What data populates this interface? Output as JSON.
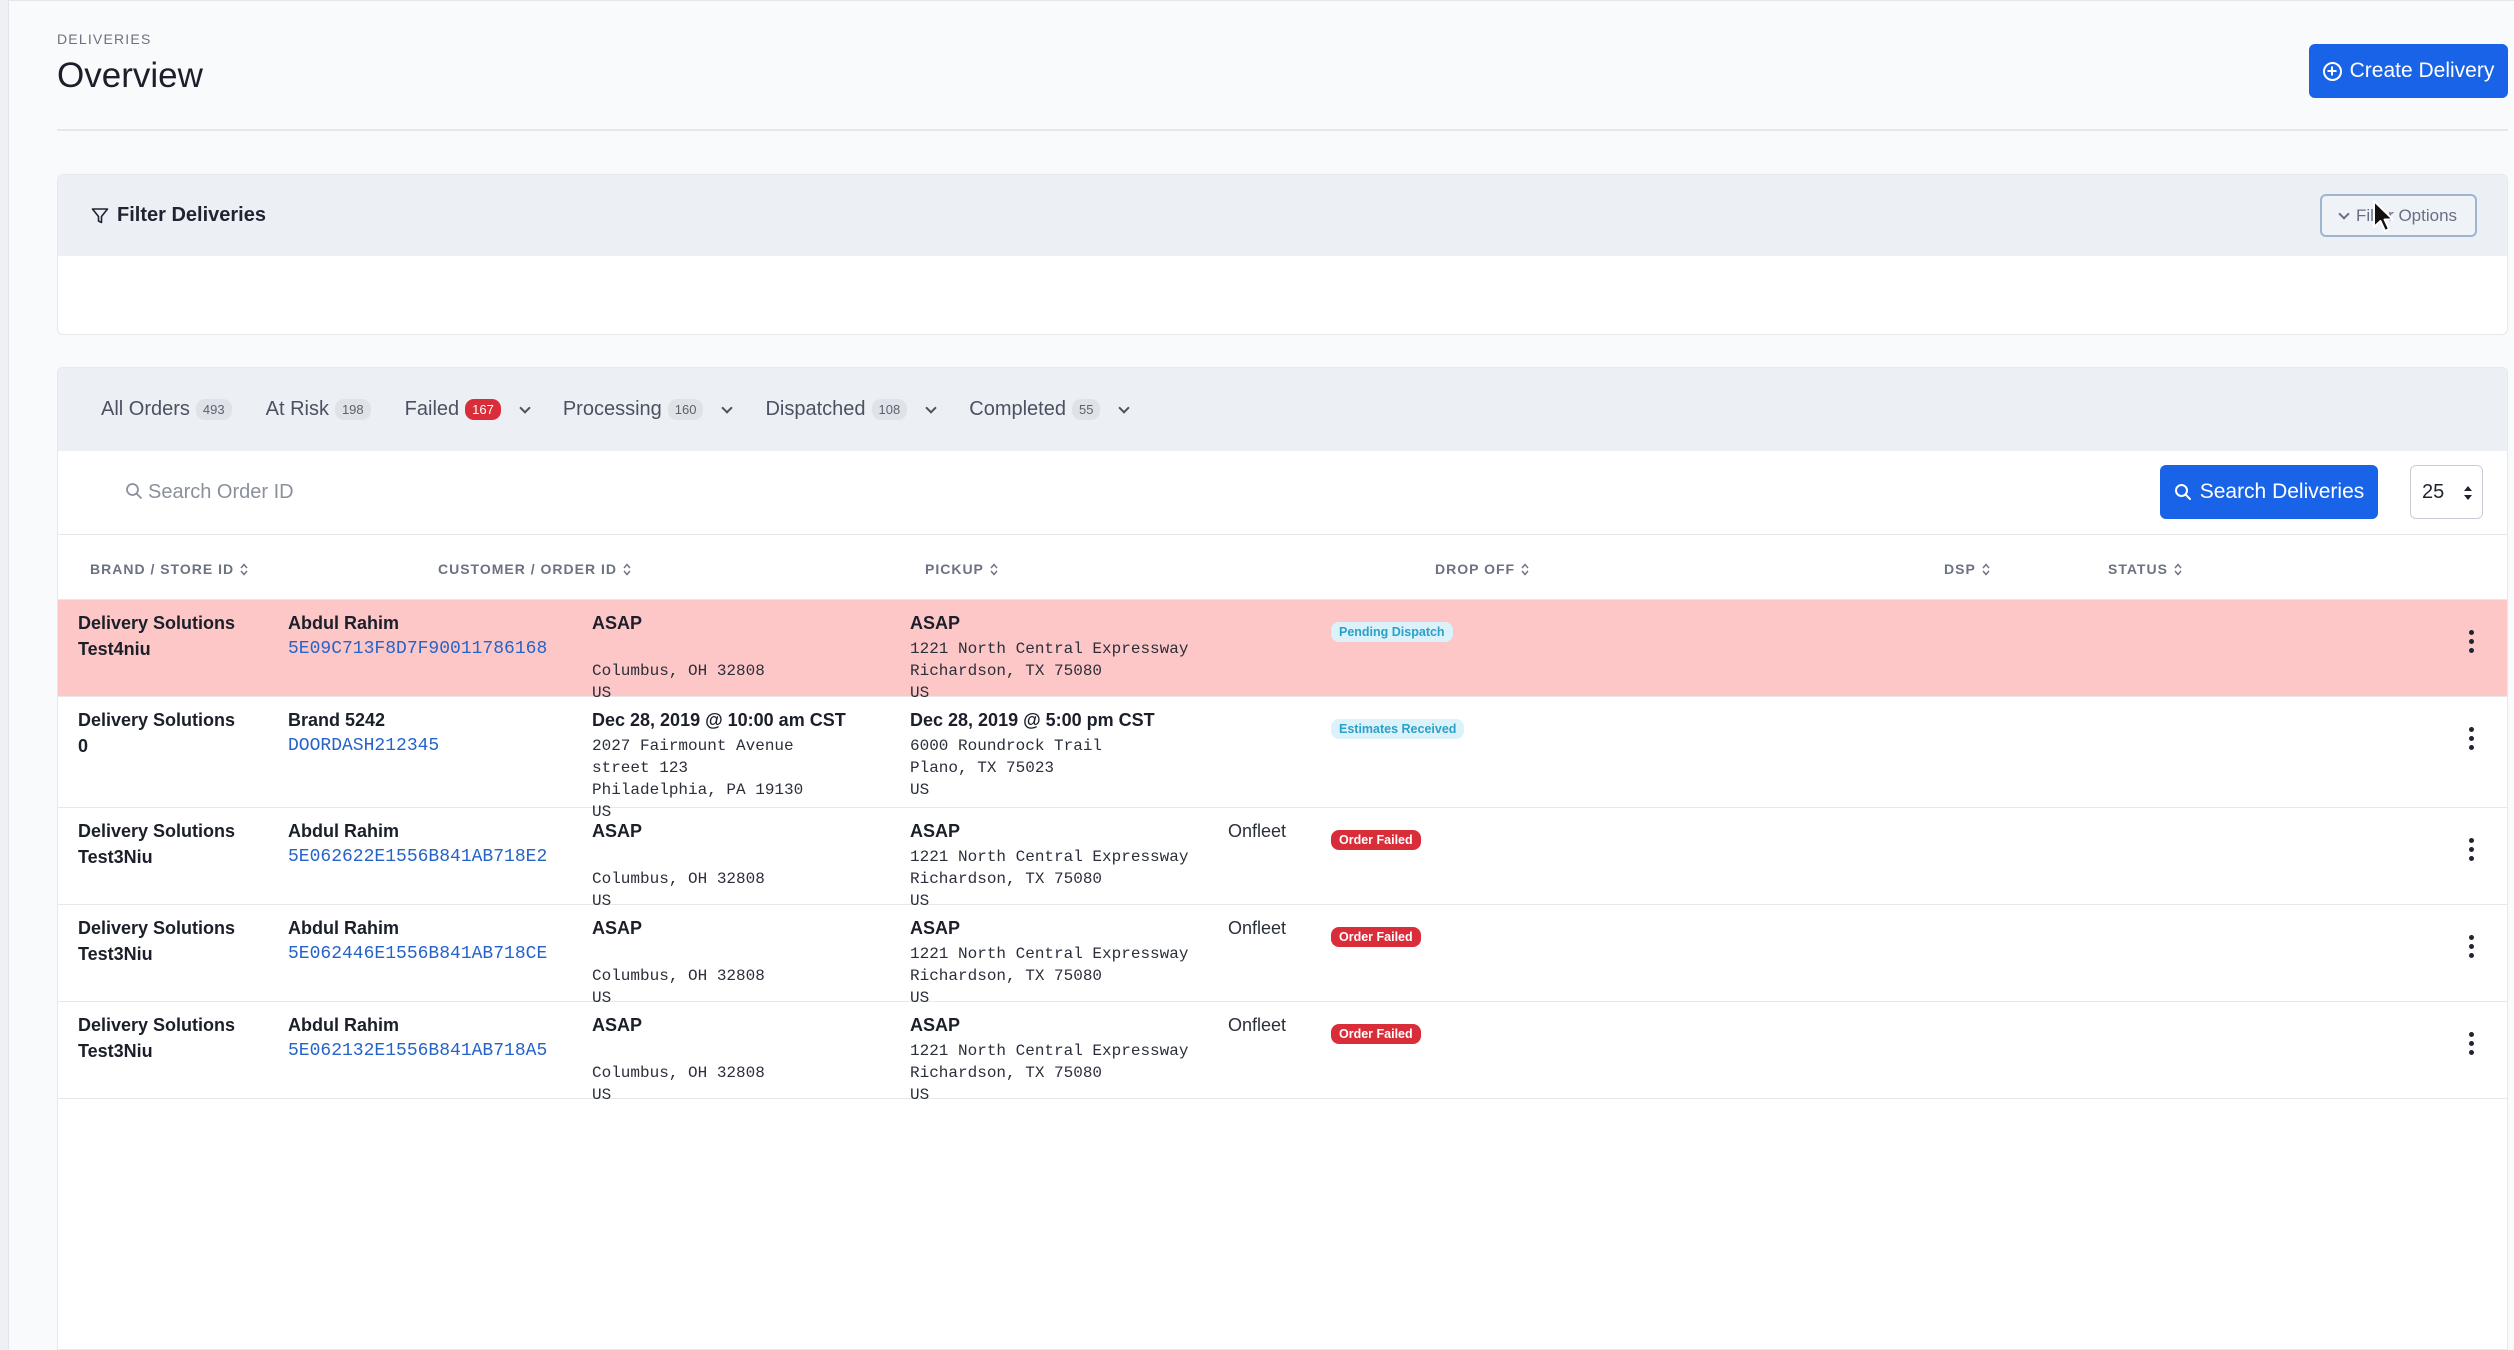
{
  "header": {
    "eyebrow": "DELIVERIES",
    "title": "Overview",
    "create_label": "Create Delivery"
  },
  "filter": {
    "title": "Filter Deliveries",
    "options_label": "Filter Options"
  },
  "tabs": [
    {
      "label": "All Orders",
      "count": "493",
      "dropdown": false
    },
    {
      "label": "At Risk",
      "count": "198",
      "dropdown": false
    },
    {
      "label": "Failed",
      "count": "167",
      "dropdown": true,
      "alert": true
    },
    {
      "label": "Processing",
      "count": "160",
      "dropdown": true
    },
    {
      "label": "Dispatched",
      "count": "108",
      "dropdown": true
    },
    {
      "label": "Completed",
      "count": "55",
      "dropdown": true
    }
  ],
  "search": {
    "placeholder": "Search Order ID",
    "button_label": "Search Deliveries",
    "page_size": "25"
  },
  "columns": {
    "brand": "BRAND / STORE ID",
    "customer": "CUSTOMER / ORDER ID",
    "pickup": "PICKUP",
    "dropoff": "DROP OFF",
    "dsp": "DSP",
    "status": "STATUS"
  },
  "rows": [
    {
      "brand": "Delivery Solutions",
      "store": "Test4niu",
      "customer": "Abdul Rahim",
      "order_id": "5E09C713F8D7F90011786168",
      "pickup_time": "ASAP",
      "pickup_lines": [
        "",
        "Columbus, OH 32808",
        "US"
      ],
      "dropoff_time": "ASAP",
      "dropoff_lines": [
        "1221 North Central Expressway",
        "Richardson, TX 75080",
        "US"
      ],
      "dsp": "",
      "status": "Pending Dispatch",
      "status_kind": "pending",
      "at_risk": true
    },
    {
      "brand": "Delivery Solutions",
      "store": "0",
      "customer": "Brand 5242",
      "order_id": "DOORDASH212345",
      "pickup_time": "Dec 28, 2019 @ 10:00 am CST",
      "pickup_lines": [
        "2027 Fairmount Avenue",
        "street 123",
        "Philadelphia, PA 19130",
        "US"
      ],
      "dropoff_time": "Dec 28, 2019 @ 5:00 pm CST",
      "dropoff_lines": [
        "6000 Roundrock Trail",
        "Plano, TX 75023",
        "US"
      ],
      "dsp": "",
      "status": "Estimates Received",
      "status_kind": "pending",
      "at_risk": false
    },
    {
      "brand": "Delivery Solutions",
      "store": "Test3Niu",
      "customer": "Abdul Rahim",
      "order_id": "5E062622E1556B841AB718E2",
      "pickup_time": "ASAP",
      "pickup_lines": [
        "",
        "Columbus, OH 32808",
        "US"
      ],
      "dropoff_time": "ASAP",
      "dropoff_lines": [
        "1221 North Central Expressway",
        "Richardson, TX 75080",
        "US"
      ],
      "dsp": "Onfleet",
      "status": "Order Failed",
      "status_kind": "failed",
      "at_risk": false
    },
    {
      "brand": "Delivery Solutions",
      "store": "Test3Niu",
      "customer": "Abdul Rahim",
      "order_id": "5E062446E1556B841AB718CE",
      "pickup_time": "ASAP",
      "pickup_lines": [
        "",
        "Columbus, OH 32808",
        "US"
      ],
      "dropoff_time": "ASAP",
      "dropoff_lines": [
        "1221 North Central Expressway",
        "Richardson, TX 75080",
        "US"
      ],
      "dsp": "Onfleet",
      "status": "Order Failed",
      "status_kind": "failed",
      "at_risk": false
    },
    {
      "brand": "Delivery Solutions",
      "store": "Test3Niu",
      "customer": "Abdul Rahim",
      "order_id": "5E062132E1556B841AB718A5",
      "pickup_time": "ASAP",
      "pickup_lines": [
        "",
        "Columbus, OH 32808",
        "US"
      ],
      "dropoff_time": "ASAP",
      "dropoff_lines": [
        "1221 North Central Expressway",
        "Richardson, TX 75080",
        "US"
      ],
      "dsp": "Onfleet",
      "status": "Order Failed",
      "status_kind": "failed",
      "at_risk": false
    }
  ]
}
